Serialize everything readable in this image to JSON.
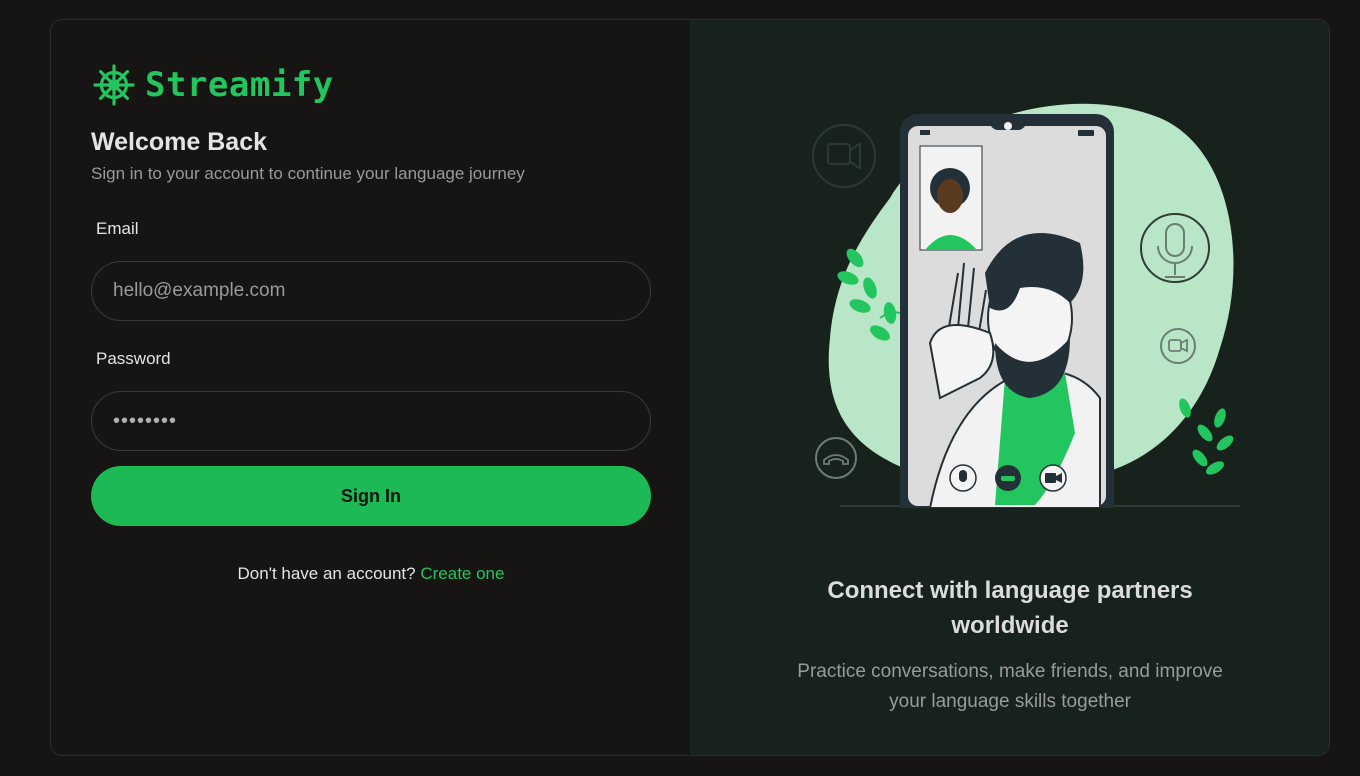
{
  "brand": {
    "name": "Streamify",
    "icon": "ship-wheel-icon",
    "accent": "#22c55e"
  },
  "login": {
    "title": "Welcome Back",
    "subtitle": "Sign in to your account to continue your language journey",
    "email_label": "Email",
    "email_placeholder": "hello@example.com",
    "email_value": "",
    "password_label": "Password",
    "password_value": "12345678",
    "submit_label": "Sign In",
    "signup_prompt": "Don't have an account?",
    "signup_link": "Create one"
  },
  "promo": {
    "title_line1": "Connect with language partners",
    "title_line2": "worldwide",
    "subtitle_line1": "Practice conversations, make friends, and improve",
    "subtitle_line2": "your language skills together"
  },
  "colors": {
    "background": "#171414",
    "panel": "#18221d",
    "button": "#1db954"
  }
}
